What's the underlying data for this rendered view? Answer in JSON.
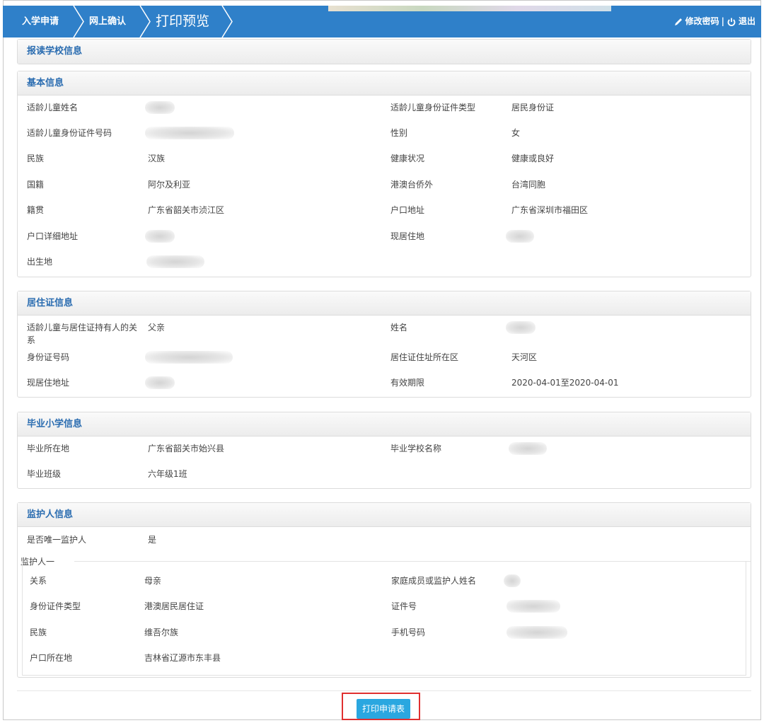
{
  "nav": {
    "crumbs": [
      "入学申请",
      "网上确认",
      "打印预览"
    ],
    "change_password": "修改密码",
    "separator": "|",
    "logout": "退出"
  },
  "school_section": {
    "title": "报读学校信息"
  },
  "basic_section": {
    "title": "基本信息",
    "labels": {
      "child_name": "适龄儿童姓名",
      "id_type": "适龄儿童身份证件类型",
      "id_number": "适龄儿童身份证件号码",
      "gender": "性别",
      "ethnicity": "民族",
      "health": "健康状况",
      "nationality": "国籍",
      "hk_macau": "港澳台侨外",
      "native_place": "籍贯",
      "hukou_address": "户口地址",
      "hukou_detail": "户口详细地址",
      "current_residence": "现居住地",
      "birthplace": "出生地"
    },
    "values": {
      "id_type": "居民身份证",
      "gender": "女",
      "ethnicity": "汉族",
      "health": "健康或良好",
      "nationality": "阿尔及利亚",
      "hk_macau": "台湾同胞",
      "native_place": "广东省韶关市浈江区",
      "hukou_address": "广东省深圳市福田区"
    }
  },
  "residence_section": {
    "title": "居住证信息",
    "labels": {
      "relation": "适龄儿童与居住证持有人的关系",
      "name": "姓名",
      "id_number": "身份证号码",
      "permit_district": "居住证住址所在区",
      "current_address": "现居住地址",
      "validity": "有效期限"
    },
    "values": {
      "relation": "父亲",
      "permit_district": "天河区",
      "validity": "2020-04-01至2020-04-01"
    }
  },
  "graduation_section": {
    "title": "毕业小学信息",
    "labels": {
      "location": "毕业所在地",
      "school_name": "毕业学校名称",
      "class": "毕业班级"
    },
    "values": {
      "location": "广东省韶关市始兴县",
      "class": "六年级1班"
    }
  },
  "guardian_section": {
    "title": "监护人信息",
    "labels": {
      "sole_guardian": "是否唯一监护人",
      "guardian_one": "监护人一",
      "relation": "关系",
      "member_name": "家庭成员或监护人姓名",
      "id_type": "身份证件类型",
      "id_number": "证件号",
      "ethnicity": "民族",
      "phone": "手机号码",
      "hukou_location": "户口所在地"
    },
    "values": {
      "sole_guardian": "是",
      "relation": "母亲",
      "id_type": "港澳居民居住证",
      "ethnicity": "维吾尔族",
      "hukou_location": "吉林省辽源市东丰县"
    }
  },
  "actions": {
    "print_button": "打印申请表"
  },
  "colors": {
    "topbar": "#2f80c9",
    "section_title": "#2a6cb0",
    "print_button": "#2aa7e0",
    "highlight_outline": "#e03030"
  }
}
